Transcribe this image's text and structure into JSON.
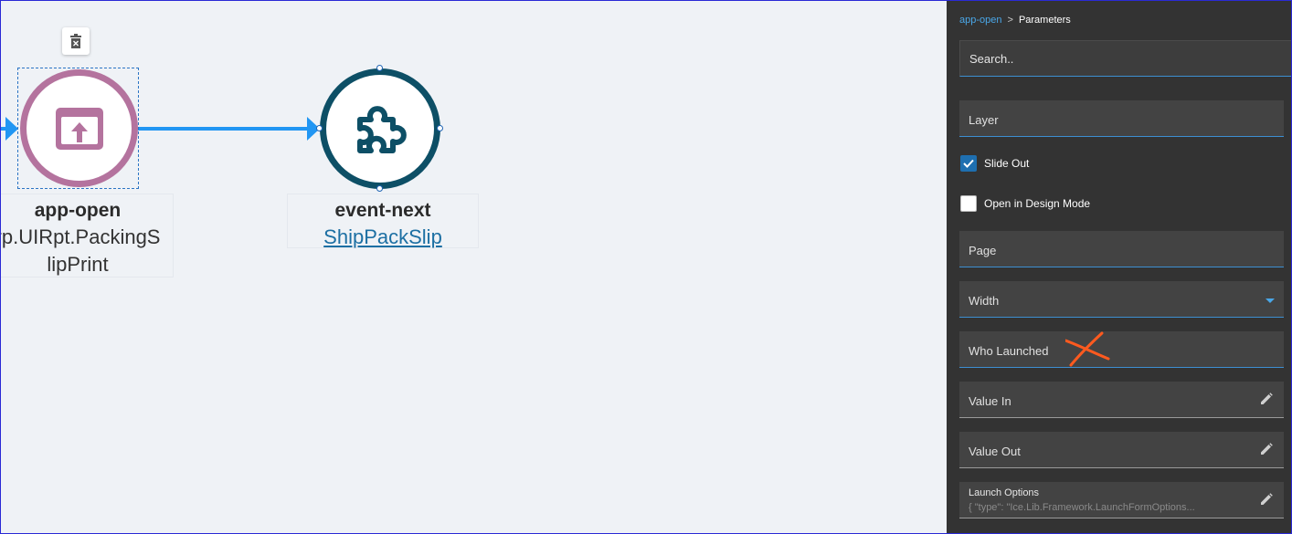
{
  "canvas": {
    "node1": {
      "title": "app-open",
      "subtitle_line1": "rp.UIRpt.PackingS",
      "subtitle_line2": "lipPrint",
      "icon": "app-open-icon",
      "color": "#b4739e"
    },
    "node2": {
      "title": "event-next",
      "link": "ShipPackSlip",
      "icon": "puzzle-piece-icon",
      "color": "#0d4f66"
    },
    "connector_color": "#2196f3"
  },
  "panel": {
    "breadcrumb": {
      "link": "app-open",
      "separator": ">",
      "current": "Parameters"
    },
    "search_placeholder": "Search..",
    "fields": {
      "layer": "Layer",
      "slide_out": "Slide Out",
      "slide_out_checked": true,
      "open_design": "Open in Design Mode",
      "open_design_checked": false,
      "page": "Page",
      "width": "Width",
      "who_launched": "Who Launched",
      "value_in": "Value In",
      "value_out": "Value Out",
      "launch_options_label": "Launch Options",
      "launch_options_value": "{ \"type\": \"Ice.Lib.Framework.LaunchFormOptions..."
    },
    "accent_color": "#3d8fd1",
    "annotation_color": "#ff5a1f"
  }
}
